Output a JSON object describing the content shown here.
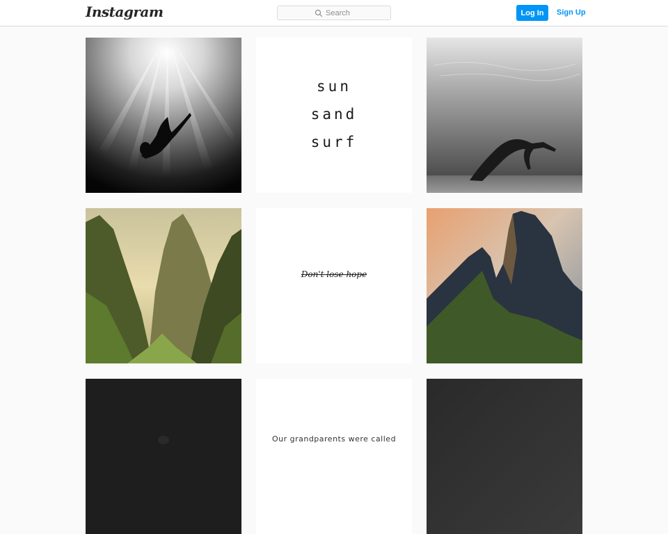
{
  "header": {
    "logo": "Instagram",
    "search": {
      "placeholder": "Search"
    },
    "login_label": "Log In",
    "signup_label": "Sign Up"
  },
  "posts": [
    {
      "kind": "photo",
      "subject": "person falling underwater, black and white"
    },
    {
      "kind": "text",
      "lines": [
        "sun",
        "sand",
        "surf"
      ]
    },
    {
      "kind": "photo",
      "subject": "person floating underwater, black and white"
    },
    {
      "kind": "photo",
      "subject": "green karst mountain gorge"
    },
    {
      "kind": "text",
      "lines": [
        "Don't lose hope"
      ]
    },
    {
      "kind": "photo",
      "subject": "mountain peak at sunset"
    },
    {
      "kind": "photo",
      "subject": "dark photo"
    },
    {
      "kind": "text",
      "lines": [
        "Our grandparents were called"
      ]
    },
    {
      "kind": "photo",
      "subject": "dark textured photo"
    }
  ],
  "colors": {
    "accent": "#0095f6",
    "background": "#fafafa",
    "border": "#dbdbdb"
  }
}
